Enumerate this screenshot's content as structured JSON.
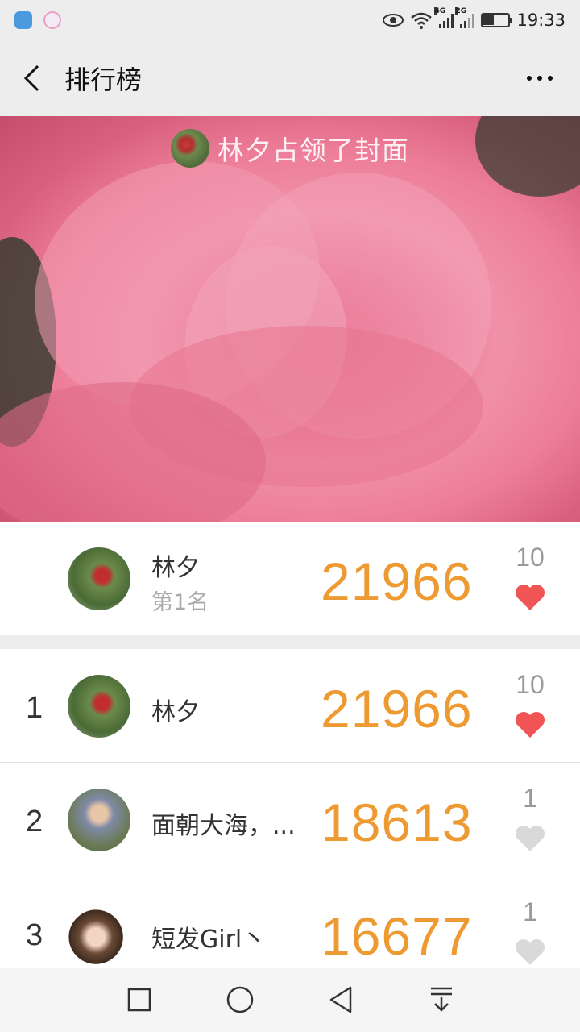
{
  "status_bar": {
    "time": "19:33",
    "net1": "4G",
    "net2": "2G"
  },
  "nav": {
    "title": "排行榜"
  },
  "cover": {
    "text": "林夕占领了封面"
  },
  "cover_holder": {
    "name": "林夕",
    "rank_label": "第1名",
    "steps": "21966",
    "likes": "10",
    "liked": true
  },
  "ranking": [
    {
      "rank": "1",
      "name": "林夕",
      "steps": "21966",
      "likes": "10",
      "liked": true
    },
    {
      "rank": "2",
      "name": "面朝大海，...",
      "steps": "18613",
      "likes": "1",
      "liked": false
    },
    {
      "rank": "3",
      "name": "短发Girl丶",
      "steps": "16677",
      "likes": "1",
      "liked": false
    }
  ],
  "colors": {
    "score": "#ee9a32",
    "heart_active": "#f05454",
    "heart_inactive": "#d9d9d9"
  }
}
